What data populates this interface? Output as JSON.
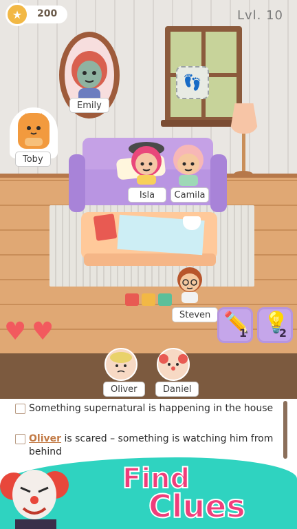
{
  "hud": {
    "coin_icon": "star-coin-icon",
    "coins": "200",
    "level": "Lvl. 10"
  },
  "characters": {
    "emily": "Emily",
    "toby": "Toby",
    "isla": "Isla",
    "camila": "Camila",
    "steven": "Steven"
  },
  "hearts": {
    "count": 2,
    "color": "#f25a5e"
  },
  "hints": [
    {
      "icon": "pencil-icon",
      "count": "1"
    },
    {
      "icon": "lightbulb-icon",
      "count": "2"
    }
  ],
  "suspects": [
    {
      "name": "Oliver"
    },
    {
      "name": "Daniel"
    }
  ],
  "clues": [
    {
      "text": "Something supernatural is happening in the house",
      "checked": false
    },
    {
      "link": "Oliver",
      "text": " is scared – something is watching him from behind",
      "checked": false
    }
  ],
  "promo": {
    "line1": "Find",
    "line2": "Clues"
  },
  "colors": {
    "accent": "#ef3e7b",
    "wave": "#2fd3c0",
    "link": "#c27a45"
  }
}
